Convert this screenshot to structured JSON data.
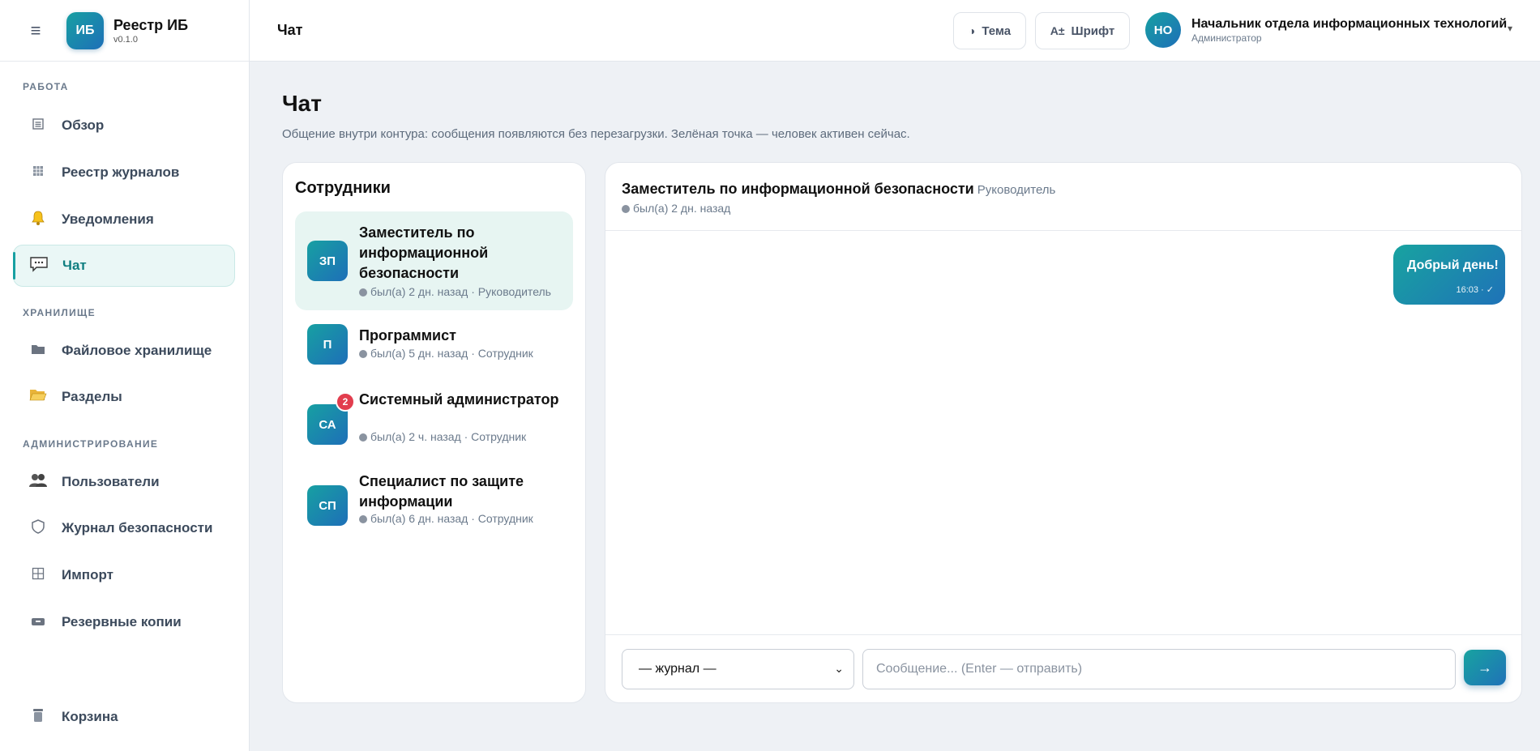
{
  "app": {
    "logo": "ИБ",
    "title": "Реестр ИБ",
    "version": "v0.1.0"
  },
  "sidebar": {
    "sections": [
      "РАБОТА",
      "ХРАНИЛИЩЕ",
      "АДМИНИСТРИРОВАНИЕ"
    ],
    "items": [
      {
        "label": "Обзор",
        "icon": "list-icon"
      },
      {
        "label": "Реестр журналов",
        "icon": "grid-icon"
      },
      {
        "label": "Уведомления",
        "icon": "bell-icon"
      },
      {
        "label": "Чат",
        "icon": "chat-icon",
        "active": true
      },
      {
        "label": "Файловое хранилище",
        "icon": "folder-icon"
      },
      {
        "label": "Разделы",
        "icon": "folder-open-icon"
      },
      {
        "label": "Пользователи",
        "icon": "users-icon"
      },
      {
        "label": "Журнал безопасности",
        "icon": "shield-icon"
      },
      {
        "label": "Импорт",
        "icon": "table-icon"
      },
      {
        "label": "Резервные копии",
        "icon": "backup-icon"
      },
      {
        "label": "Корзина",
        "icon": "trash-icon"
      }
    ]
  },
  "topbar": {
    "title": "Чат",
    "theme_label": "Тема",
    "font_icon": "A±",
    "font_label": "Шрифт",
    "user": {
      "initials": "НО",
      "name": "Начальник отдела информационных технологий",
      "role": "Администратор"
    }
  },
  "page": {
    "title": "Чат",
    "subtitle": "Общение внутри контура: сообщения появляются без перезагрузки. Зелёная точка — человек активен сейчас."
  },
  "employees": {
    "title": "Сотрудники",
    "list": [
      {
        "initials": "ЗП",
        "name": "Заместитель по информационной безопасности",
        "meta": "был(а) 2 дн. назад · Руководитель",
        "selected": true
      },
      {
        "initials": "П",
        "name": "Программист",
        "meta": "был(а) 5 дн. назад · Сотрудник"
      },
      {
        "initials": "СА",
        "name": "Системный администратор",
        "meta": "был(а) 2 ч. назад · Сотрудник",
        "badge": "2"
      },
      {
        "initials": "СП",
        "name": "Специалист по защите информации",
        "meta": "был(а) 6 дн. назад · Сотрудник"
      }
    ]
  },
  "chat": {
    "header": {
      "name": "Заместитель по информационной безопасности",
      "role": "Руководитель",
      "status": "был(а) 2 дн. назад"
    },
    "messages": [
      {
        "text": "Добрый день!",
        "time": "16:03 · ✓"
      }
    ],
    "journal_select": "— журнал —",
    "input_placeholder": "Сообщение... (Enter — отправить)",
    "send_label": "→"
  },
  "colors": {
    "accent": "#17a0a2",
    "accent_blue": "#1e6fb8",
    "badge": "#e23d4e",
    "selected_bg": "#e7f5f2"
  }
}
